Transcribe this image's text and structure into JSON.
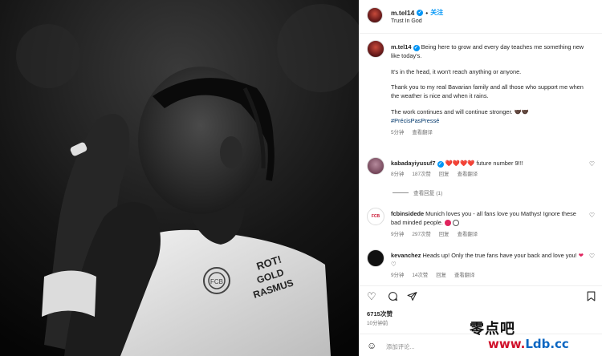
{
  "header": {
    "username": "m.tel14",
    "separator": "•",
    "follow_label": "关注",
    "subtitle": "Trust In God"
  },
  "caption": {
    "username": "m.tel14",
    "line1": "Being here to grow and every day teaches me something new like today's.",
    "line2": "It's in the head, it won't reach anything or anyone.",
    "line3": "Thank you to my real Bavarian family and all those who support me when the weather is nice and when it rains.",
    "line4": "The work continues and will continue stronger. 🤝🏿🤝🏿",
    "hashtag": "#PrécisPasPressé",
    "time": "5分钟",
    "translate": "查看翻译"
  },
  "comments": [
    {
      "username": "kabadayiyusuf7",
      "text": "future number 9!!!",
      "hearts": "❤️❤️❤️❤️",
      "time": "8分钟",
      "likes": "187次赞",
      "reply": "回复",
      "translate": "查看翻译",
      "view_replies": "查看回复 (1)"
    },
    {
      "username": "fcbinsidede",
      "text": "Munich loves you - all fans love you Mathys! Ignore these bad minded people.",
      "time": "9分钟",
      "likes": "297次赞",
      "reply": "回复",
      "translate": "查看翻译"
    },
    {
      "username": "kevanchez",
      "text": "Heads up! Only the true fans have your back and love you!",
      "time": "9分钟",
      "likes": "14次赞",
      "reply": "回复",
      "translate": "查看翻译"
    }
  ],
  "post": {
    "likes": "6715次赞",
    "time": "10分钟前",
    "comment_placeholder": "添加评论..."
  },
  "photo": {
    "jersey_text_1": "ROT!",
    "jersey_text_2": "GOLD",
    "jersey_text_3": "RASMUS",
    "crest_text": "FCB"
  },
  "watermark": {
    "chinese": "零点吧",
    "url_part1": "www.",
    "url_part2": "Ldb.cc"
  },
  "icons": {
    "verified": "verified-badge-icon",
    "heart": "heart-icon",
    "comment": "comment-icon",
    "share": "share-icon",
    "save": "bookmark-icon",
    "emoji": "emoji-icon"
  },
  "colors": {
    "accent": "#0095f6",
    "heart": "#e0245e",
    "hashtag": "#00376b",
    "muted": "#737373"
  }
}
